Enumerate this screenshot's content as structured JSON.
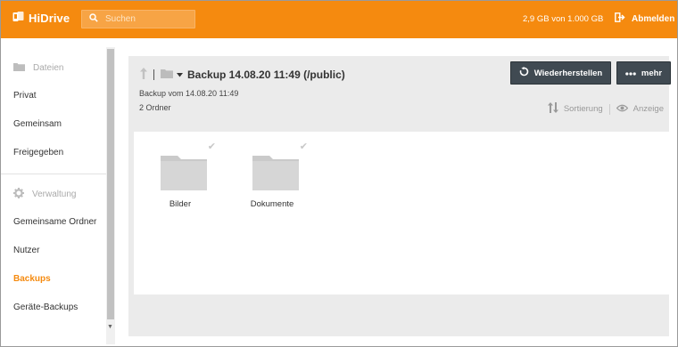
{
  "header": {
    "logo_text": "HiDrive",
    "search_placeholder": "Suchen",
    "storage_text": "2,9 GB von 1.000 GB",
    "logout_label": "Abmelden",
    "brand_color": "#f58a0f"
  },
  "sidebar": {
    "section_files": "Dateien",
    "items_top": [
      "Privat",
      "Gemeinsam",
      "Freigegeben"
    ],
    "section_admin": "Verwaltung",
    "items_admin": [
      "Gemeinsame Ordner",
      "Nutzer",
      "Backups",
      "Geräte-Backups"
    ],
    "active_item": "Backups",
    "icons": {
      "files": "folder-icon",
      "admin": "gear-icon"
    }
  },
  "main": {
    "title": "Backup 14.08.20 11:49 (/public)",
    "backup_line": "Backup vom 14.08.20 11:49",
    "folder_count": "2 Ordner",
    "restore_button": "Wiederherstellen",
    "more_button": "mehr",
    "sort_label": "Sortierung",
    "view_label": "Anzeige",
    "folders": [
      {
        "name": "Bilder"
      },
      {
        "name": "Dokumente"
      }
    ]
  }
}
